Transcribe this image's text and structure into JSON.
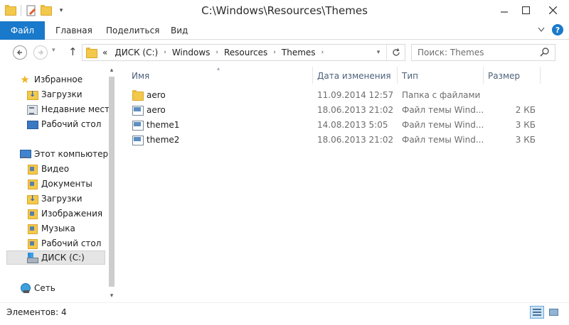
{
  "window": {
    "title": "C:\\Windows\\Resources\\Themes",
    "minimize_icon": "minimize-icon",
    "maximize_icon": "maximize-icon",
    "close_icon": "close-icon"
  },
  "ribbon": {
    "tabs": [
      {
        "label": "Файл",
        "active": true
      },
      {
        "label": "Главная"
      },
      {
        "label": "Поделиться"
      },
      {
        "label": "Вид"
      }
    ],
    "accent": "#1979ca",
    "help_label": "?"
  },
  "nav": {
    "up_arrow": "↑",
    "breadcrumbs": [
      "«",
      "ДИСК (C:)",
      "Windows",
      "Resources",
      "Themes"
    ],
    "search_placeholder": "Поиск: Themes"
  },
  "sidebar": {
    "items": [
      {
        "label": "Избранное",
        "icon": "star-icon"
      },
      {
        "label": "Загрузки",
        "icon": "downloads-folder-icon"
      },
      {
        "label": "Недавние места",
        "icon": "recent-places-icon"
      },
      {
        "label": "Рабочий стол",
        "icon": "desktop-icon"
      },
      {
        "label": "Этот компьютер",
        "icon": "computer-icon"
      },
      {
        "label": "Видео",
        "icon": "videos-library-icon"
      },
      {
        "label": "Документы",
        "icon": "documents-library-icon"
      },
      {
        "label": "Загрузки",
        "icon": "downloads-library-icon"
      },
      {
        "label": "Изображения",
        "icon": "pictures-library-icon"
      },
      {
        "label": "Музыка",
        "icon": "music-library-icon"
      },
      {
        "label": "Рабочий стол",
        "icon": "desktop-library-icon"
      },
      {
        "label": "ДИСК (C:)",
        "icon": "drive-icon",
        "selected": true
      },
      {
        "label": "Сеть",
        "icon": "network-icon"
      }
    ]
  },
  "filelist": {
    "columns": [
      "Имя",
      "Дата изменения",
      "Тип",
      "Размер"
    ],
    "rows": [
      {
        "name": "aero",
        "date": "11.09.2014 12:57",
        "type": "Папка с файлами",
        "size": "",
        "icon": "folder-icon"
      },
      {
        "name": "aero",
        "date": "18.06.2013 21:02",
        "type": "Файл темы Wind...",
        "size": "2 КБ",
        "icon": "theme-file-icon"
      },
      {
        "name": "theme1",
        "date": "14.08.2013 5:05",
        "type": "Файл темы Wind...",
        "size": "3 КБ",
        "icon": "theme-file-icon"
      },
      {
        "name": "theme2",
        "date": "18.06.2013 21:02",
        "type": "Файл темы Wind...",
        "size": "3 КБ",
        "icon": "theme-file-icon"
      }
    ]
  },
  "status": {
    "items_count": "Элементов: 4"
  }
}
